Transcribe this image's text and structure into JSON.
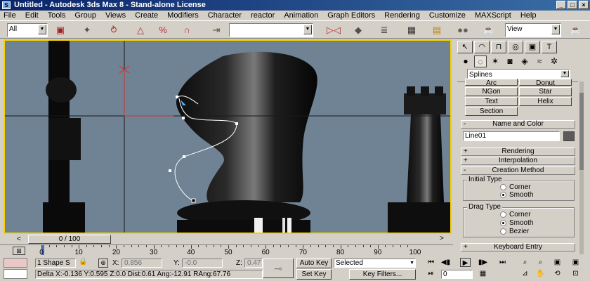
{
  "window": {
    "title": "Untitled - Autodesk 3ds Max 8 - Stand-alone License",
    "app_icon": "S",
    "minimize": "_",
    "restore": "□",
    "close": "×"
  },
  "menu": [
    "File",
    "Edit",
    "Tools",
    "Group",
    "Views",
    "Create",
    "Modifiers",
    "Character",
    "reactor",
    "Animation",
    "Graph Editors",
    "Rendering",
    "Customize",
    "MAXScript",
    "Help"
  ],
  "toolbar": {
    "selection_filter": "All",
    "ref_coord": "View",
    "named_selection": "",
    "icons": [
      "link-icon",
      "unlink-icon",
      "bind-spacewarp-icon",
      "select-icon",
      "select-region-icon",
      "move-icon",
      "rotate-icon",
      "scale-icon",
      "snap-icon",
      "angle-snap-icon",
      "percent-snap-icon",
      "spinner-snap-icon",
      "mirror-icon",
      "align-icon",
      "layers-icon",
      "curve-editor-icon",
      "schematic-icon",
      "material-editor-icon",
      "render-scene-icon",
      "quick-render-icon"
    ]
  },
  "command_panel": {
    "dropdown": "Splines",
    "object_type_buttons": [
      "Arc",
      "Donut",
      "NGon",
      "Star",
      "Text",
      "Helix",
      "Section"
    ],
    "rollouts": {
      "name_and_color": {
        "title": "Name and Color",
        "name_value": "Line01",
        "color": "#5a5a5a",
        "sign": "-"
      },
      "rendering": {
        "title": "Rendering",
        "sign": "+"
      },
      "interpolation": {
        "title": "Interpolation",
        "sign": "+"
      },
      "creation_method": {
        "title": "Creation Method",
        "sign": "-"
      },
      "keyboard_entry": {
        "title": "Keyboard Entry",
        "sign": "+"
      }
    },
    "initial_type": {
      "label": "Initial Type",
      "options": [
        "Corner",
        "Smooth"
      ],
      "selected": "Smooth"
    },
    "drag_type": {
      "label": "Drag Type",
      "options": [
        "Corner",
        "Smooth",
        "Bezier"
      ],
      "selected": "Smooth"
    }
  },
  "time_slider": {
    "label": "0 / 100",
    "prev": "<",
    "next": ">"
  },
  "ruler": {
    "ticks": [
      0,
      10,
      20,
      30,
      40,
      50,
      60,
      70,
      80,
      90,
      100
    ]
  },
  "status": {
    "selection": "1 Shape S",
    "x_label": "X:",
    "x_value": "0.856",
    "y_label": "Y:",
    "y_value": "-0.0",
    "z_label": "Z:",
    "z_value": "0.47",
    "prompt": "Delta X:-0.136  Y:0.595  Z:0.0  Dist:0.61  Ang:-12.91  RAng:67.76",
    "auto_key": "Auto Key",
    "set_key": "Set Key",
    "key_mode": "Selected",
    "key_filters": "Key Filters...",
    "frame": "0"
  }
}
